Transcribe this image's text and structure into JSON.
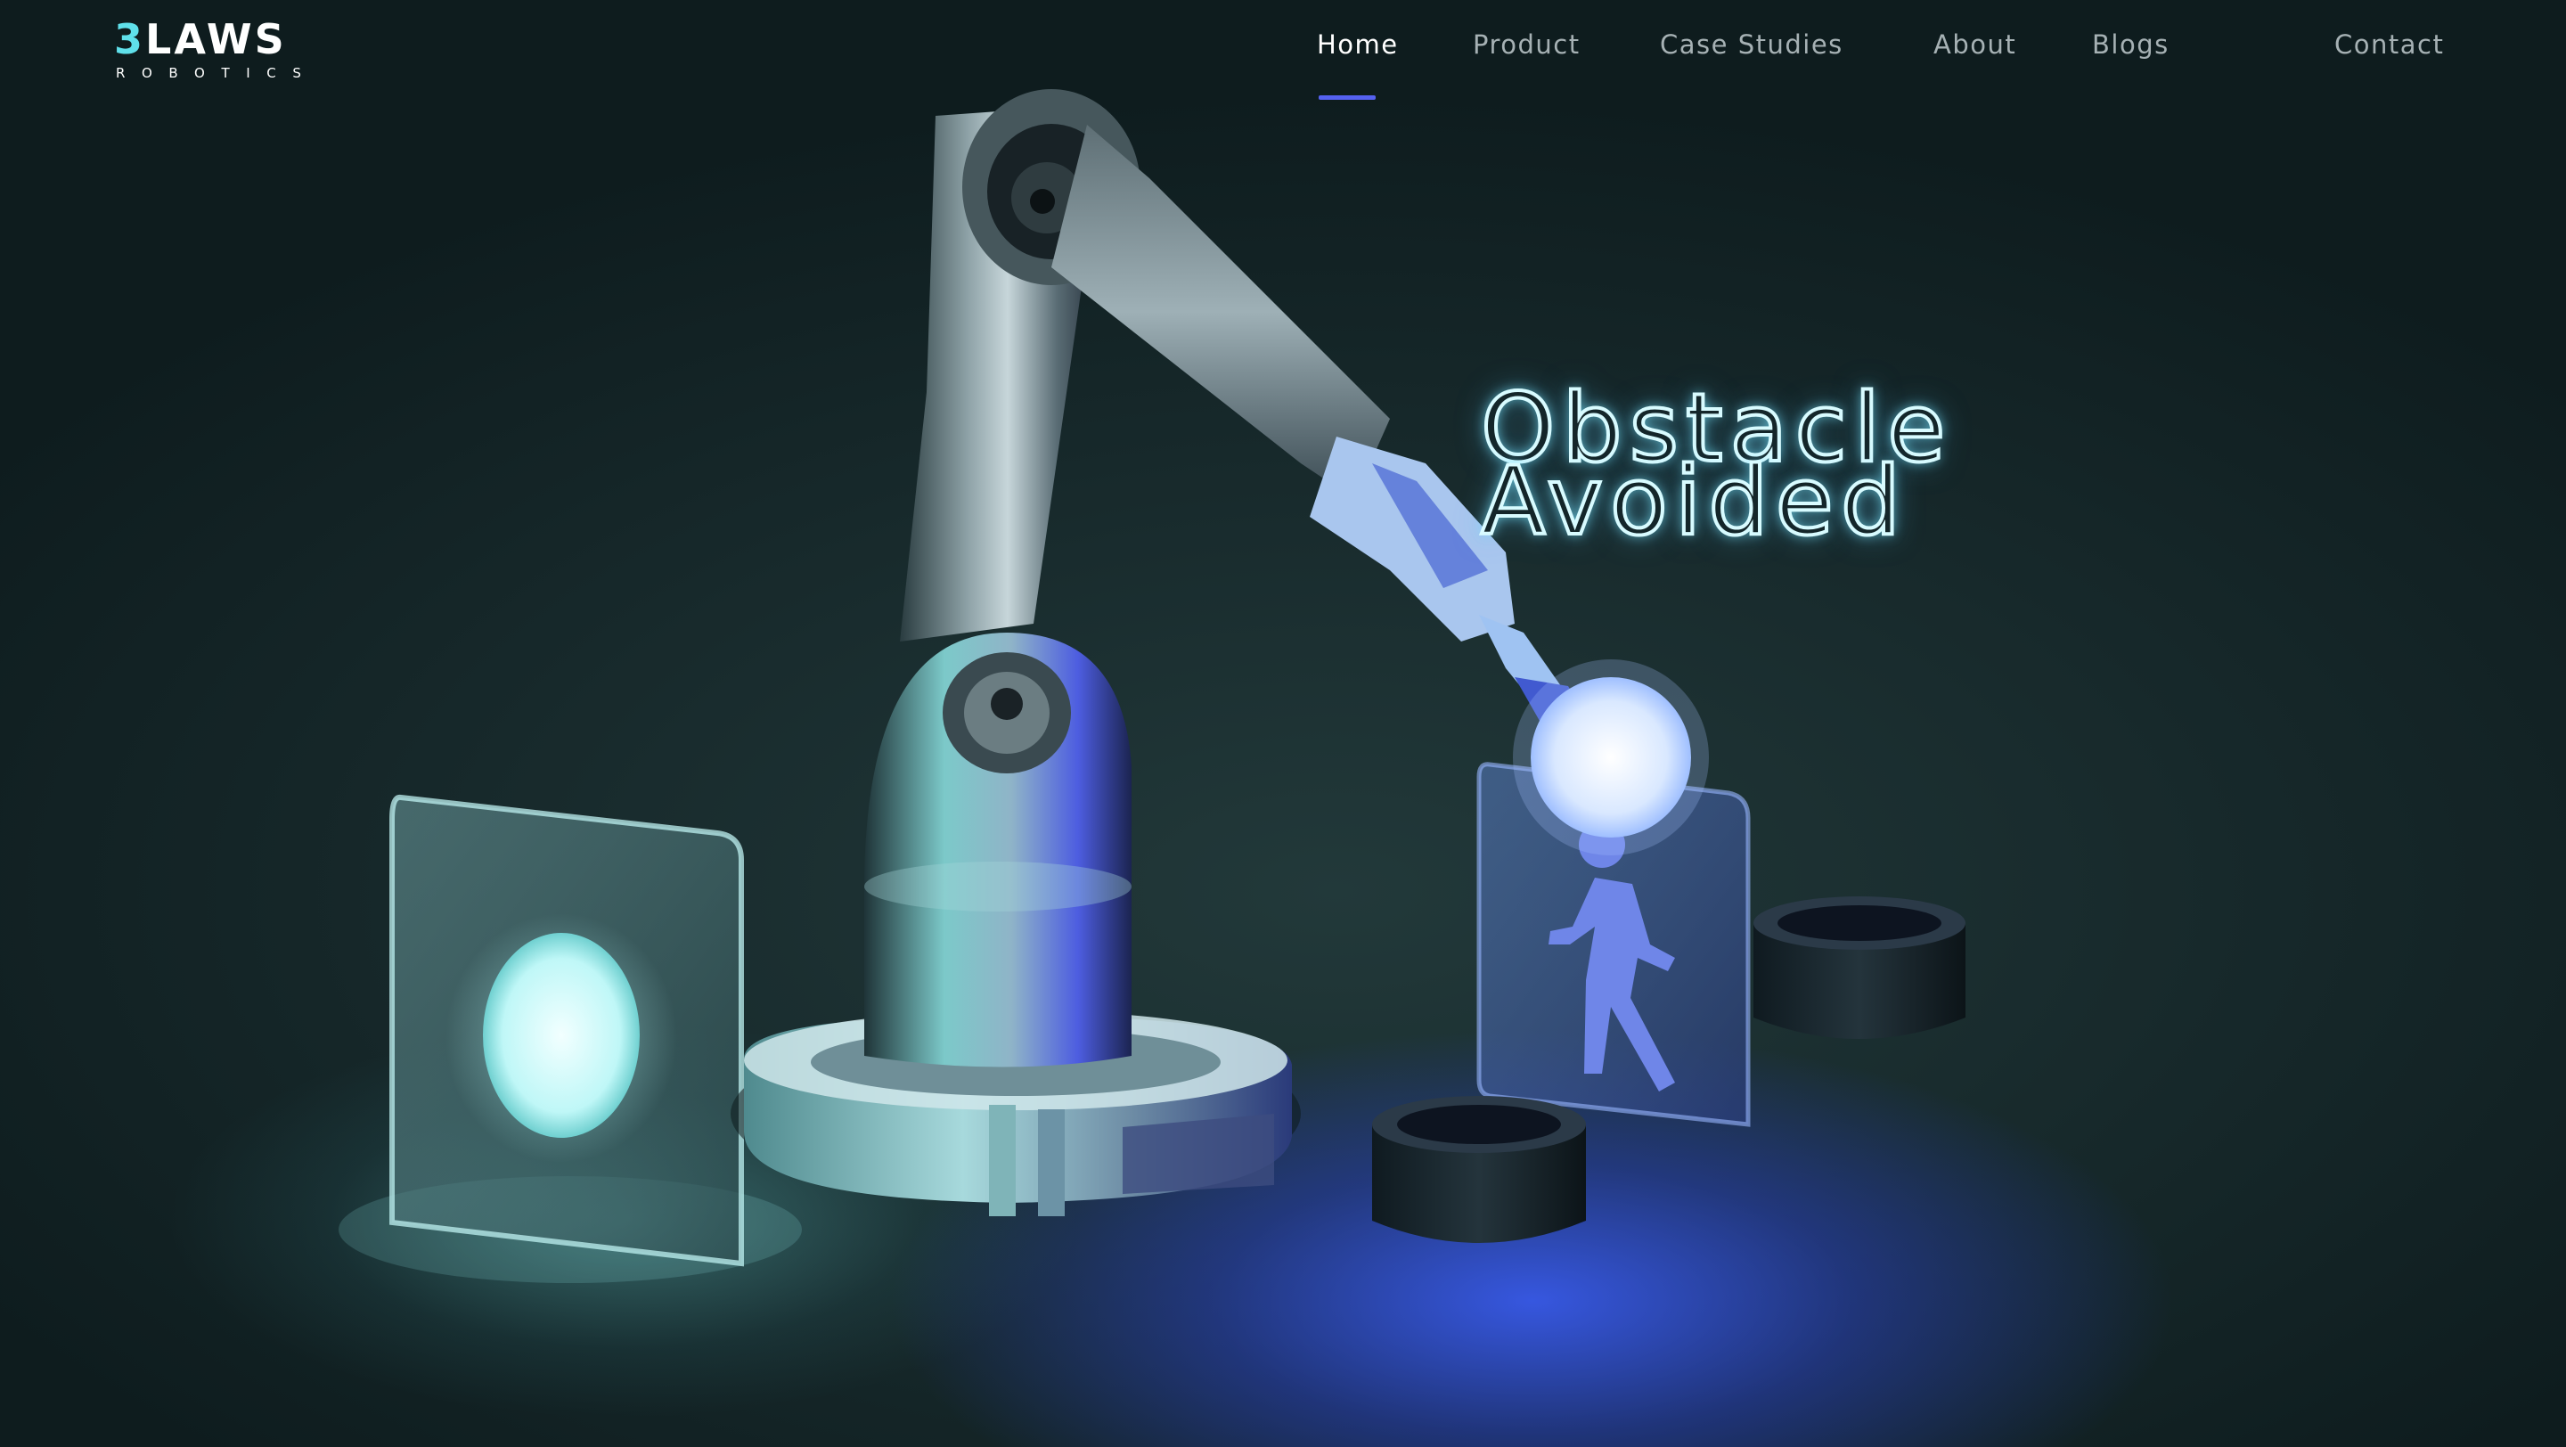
{
  "brand": {
    "wordmark_accent": "3",
    "wordmark_rest": "LAWS",
    "tagline": "ROBOTICS"
  },
  "nav": {
    "active": "Home",
    "items": [
      "Home",
      "Product",
      "Case Studies",
      "About",
      "Blogs"
    ],
    "contact": "Contact"
  },
  "hero": {
    "headline_line1": "Obstacle",
    "headline_line2": "Avoided"
  },
  "colors": {
    "accent_underline": "#5561f0",
    "logo_accent": "#5fe0ea",
    "nav_text": "#a6b1b4",
    "headline_glow": "#d8fbff"
  },
  "icons": {
    "sign_icon": "walking-person-icon"
  }
}
